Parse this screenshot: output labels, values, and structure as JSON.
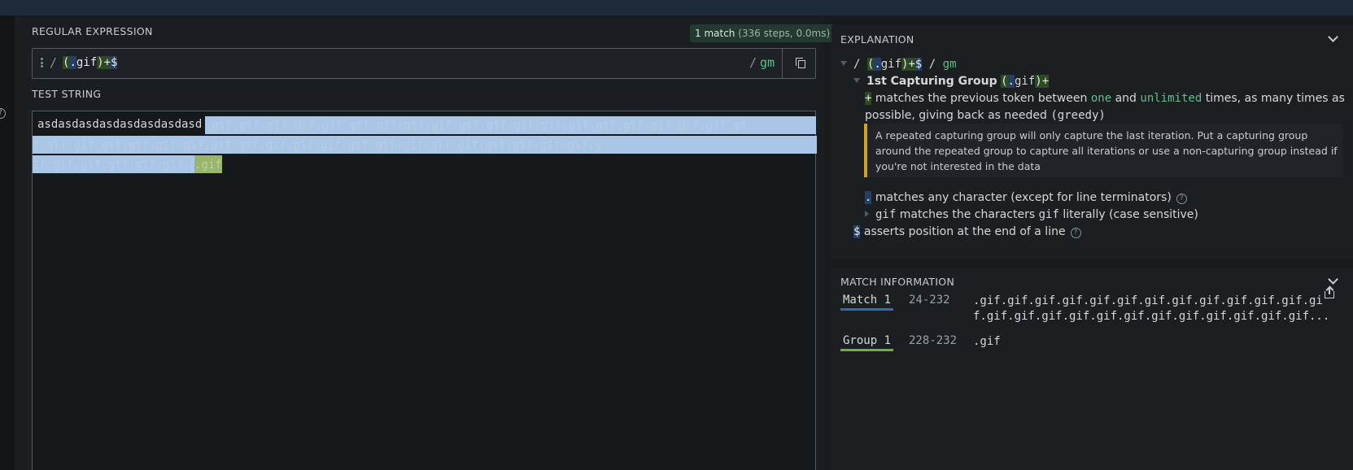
{
  "regex_section": {
    "label": "REGULAR EXPRESSION",
    "match_badge": {
      "count": "1 match",
      "steps": "(336 steps, 0.0ms)"
    },
    "delimiter_open": "/",
    "pattern_tokens": [
      "(",
      ".",
      "gif",
      ")",
      "+",
      "$"
    ],
    "flags_slash": "/",
    "flags": "gm"
  },
  "test_section": {
    "label": "TEST STRING",
    "prefix": "asdasdasdasdasdasdasdasd",
    "line1_match": ".gif.gif.gif.gif.gif.gif.gif.gif.gif.gif.gif.gif.gif.gif.gif.gif.gif.gif.gif.gi",
    "line2_match": "f.gif.gif.gif.gif.gif.gif.gif.gif.gif.gif.gif.gif.gif.gif.gif.gif.gif.gif.gif.gif.g",
    "line3_match": "if.gif.gif.gif.gif.gif.gif",
    "line3_group": ".gif"
  },
  "explanation": {
    "title": "EXPLANATION",
    "root": {
      "slash_open": "/",
      "slash_close": "/",
      "flags": "gm"
    },
    "group_heading": "1st Capturing Group",
    "quant_desc_pre": " matches the previous token between ",
    "quant_one": "one",
    "quant_and": " and ",
    "quant_unlimited": "unlimited",
    "quant_desc_post": " times, as many times as",
    "quant_desc_line2": "possible, giving back as needed",
    "quant_greedy": "(greedy)",
    "note": "A repeated capturing group will only capture the last iteration. Put a capturing group around the repeated group to capture all iterations or use a non-capturing group instead if you're not interested in the data",
    "dot_desc": " matches any character (except for line terminators)",
    "gif_token": "gif",
    "gif_desc_pre": " matches the characters ",
    "gif_desc_post": " literally (case sensitive)",
    "dollar_desc": " asserts position at the end of a line",
    "help_glyph": "?"
  },
  "match_info": {
    "title": "MATCH INFORMATION",
    "rows": [
      {
        "label": "Match 1",
        "range": "24-232",
        "value_line1": ".gif.gif.gif.gif.gif.gif.gif.gif.gif.gif.gif.gif.gi",
        "value_line2": "f.gif.gif.gif.gif.gif.gif.gif.gif.gif.gif.gif.gif...",
        "color": "#2f6db5"
      },
      {
        "label": "Group 1",
        "range": "228-232",
        "value_line1": ".gif",
        "color": "#6bb33a"
      }
    ]
  },
  "colors": {
    "match_highlight": "#a9c6e6",
    "group_highlight": "#97b56b",
    "warning_border": "#d4a11f",
    "flag_green": "#62bd8a"
  },
  "icons": [
    "grip-icon",
    "copy-icon",
    "chevron-down-icon",
    "help-icon",
    "share-icon",
    "triangle-down-icon",
    "triangle-right-icon"
  ]
}
